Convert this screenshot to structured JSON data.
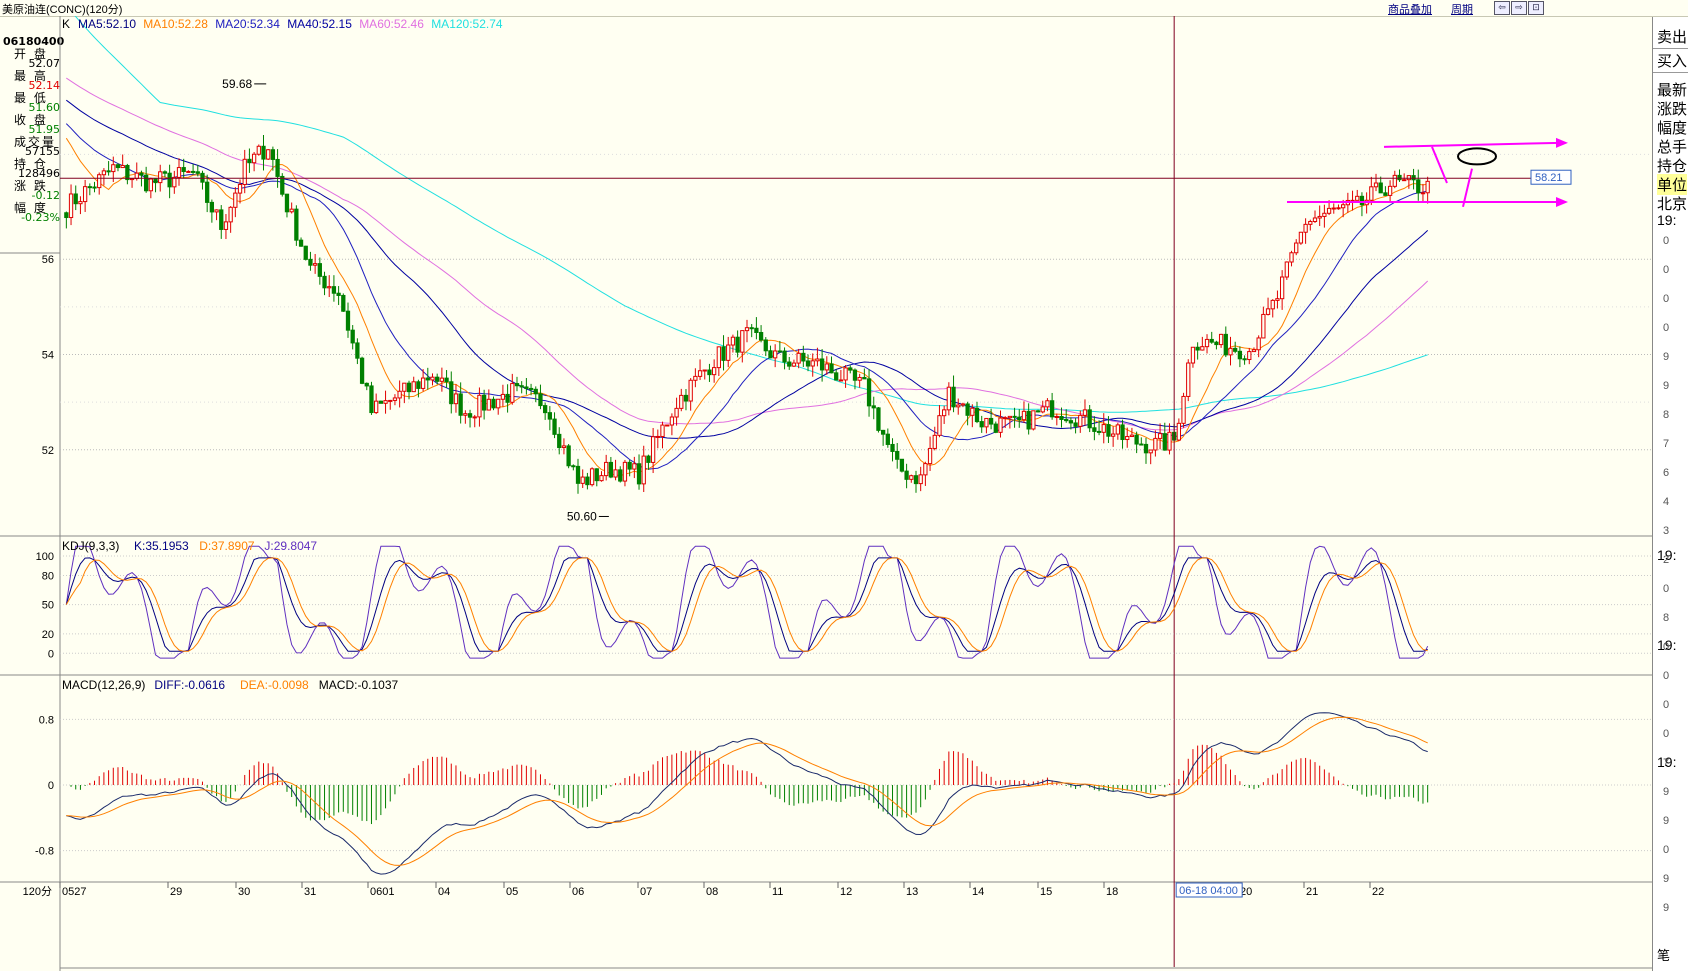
{
  "window": {
    "title": "美原油连(CONC)(120分)",
    "overlay_button": "商品叠加",
    "period_button": "周期",
    "controls": [
      "⇦",
      "⇨",
      "⊡"
    ]
  },
  "quote_panel": {
    "code": "06180400",
    "rows": [
      {
        "label": "开 盘",
        "value": "52.07",
        "color": "#000000"
      },
      {
        "label": "最 高",
        "value": "52.14",
        "color": "#e00000"
      },
      {
        "label": "最 低",
        "value": "51.60",
        "color": "#008000"
      },
      {
        "label": "收 盘",
        "value": "51.95",
        "color": "#008000"
      },
      {
        "label": "成交量",
        "value": "57155",
        "color": "#000000"
      },
      {
        "label": "持 仓",
        "value": "128496",
        "color": "#000000"
      },
      {
        "label": "涨 跌",
        "value": "-0.12",
        "color": "#008000"
      },
      {
        "label": "幅 度",
        "value": "-0.23%",
        "color": "#008000"
      }
    ]
  },
  "right_panel": {
    "buttons": [
      "卖出",
      "买入"
    ],
    "fields": [
      "最新",
      "涨跌",
      "幅度",
      "总手",
      "持仓",
      "单位",
      "北京"
    ],
    "times": [
      "19:",
      "19:",
      "19:",
      "19:"
    ],
    "ticks": [
      "0",
      "0",
      "0",
      "0",
      "9",
      "9",
      "8",
      "7",
      "6",
      "4",
      "3",
      "2",
      "0",
      "8",
      "0",
      "0",
      "0",
      "0",
      "7",
      "9",
      "9",
      "0",
      "9",
      "9"
    ],
    "footer": "笔"
  },
  "colors": {
    "background": "#fffff2",
    "up": "#e00000",
    "down": "#008000",
    "ma5": "#000080",
    "ma10": "#ff8000",
    "ma20": "#2020c0",
    "ma40": "#0000a0",
    "ma60": "#e070e0",
    "ma120": "#20e0e0",
    "annotation": "#ff00ff"
  },
  "price_panel": {
    "indicator_name": "K",
    "ma_readout": [
      {
        "text": "MA5:52.10",
        "color": "#000080"
      },
      {
        "text": "MA10:52.28",
        "color": "#ff8000"
      },
      {
        "text": "MA20:52.34",
        "color": "#2020c0"
      },
      {
        "text": "MA40:52.15",
        "color": "#0000a0"
      },
      {
        "text": "MA60:52.46",
        "color": "#e070e0"
      },
      {
        "text": "MA120:52.74",
        "color": "#20e0e0"
      }
    ],
    "y_ticks": [
      "56",
      "54",
      "52"
    ],
    "high_label": "59.68",
    "low_label": "50.60",
    "cursor_price": "58.21"
  },
  "kdj_panel": {
    "name": "KDJ(9,3,3)",
    "k": "K:35.1953",
    "d": "D:37.8907",
    "j": "J:29.8047",
    "y_ticks": [
      "100",
      "80",
      "50",
      "20",
      "0"
    ]
  },
  "macd_panel": {
    "name": "MACD(12,26,9)",
    "diff": "DIFF:-0.0616",
    "dea": "DEA:-0.0098",
    "macd": "MACD:-0.1037",
    "y_ticks": [
      "0.8",
      "0",
      "-0.8"
    ]
  },
  "x_axis": {
    "period_label": "120分",
    "labels": [
      "0527",
      "29",
      "30",
      "31",
      "0601",
      "04",
      "05",
      "06",
      "07",
      "08",
      "11",
      "12",
      "13",
      "14",
      "15",
      "18",
      "20",
      "21",
      "22"
    ],
    "cursor_time": "06-18 04:00"
  },
  "chart_data": {
    "type": "candlestick",
    "instrument": "美原油连(CONC)",
    "period": "120分",
    "y_range": [
      50.4,
      61.0
    ],
    "price_levels": [
      56,
      54,
      52
    ],
    "anchors": [
      [
        0,
        57.1
      ],
      [
        10,
        57.9
      ],
      [
        18,
        57.6
      ],
      [
        27,
        57.8
      ],
      [
        33,
        56.7
      ],
      [
        38,
        57.9
      ],
      [
        43,
        58.4
      ],
      [
        46,
        57.4
      ],
      [
        52,
        55.8
      ],
      [
        58,
        55.3
      ],
      [
        65,
        52.8
      ],
      [
        72,
        53.2
      ],
      [
        78,
        53.6
      ],
      [
        85,
        52.8
      ],
      [
        95,
        53.2
      ],
      [
        102,
        53.0
      ],
      [
        109,
        51.3
      ],
      [
        116,
        51.6
      ],
      [
        122,
        51.5
      ],
      [
        130,
        53.0
      ],
      [
        138,
        53.9
      ],
      [
        145,
        54.4
      ],
      [
        152,
        53.9
      ],
      [
        160,
        53.8
      ],
      [
        170,
        53.3
      ],
      [
        177,
        51.6
      ],
      [
        182,
        51.4
      ],
      [
        188,
        53.2
      ],
      [
        195,
        52.6
      ],
      [
        202,
        52.5
      ],
      [
        210,
        52.9
      ],
      [
        218,
        52.6
      ],
      [
        226,
        52.2
      ],
      [
        232,
        52.1
      ],
      [
        236,
        52.2
      ],
      [
        240,
        54.3
      ],
      [
        246,
        54.2
      ],
      [
        252,
        54.1
      ],
      [
        258,
        55.2
      ],
      [
        264,
        56.8
      ],
      [
        270,
        57.0
      ],
      [
        275,
        57.1
      ],
      [
        282,
        57.6
      ],
      [
        290,
        57.5
      ]
    ],
    "extremes": {
      "high": 59.68,
      "low": 50.6
    }
  }
}
